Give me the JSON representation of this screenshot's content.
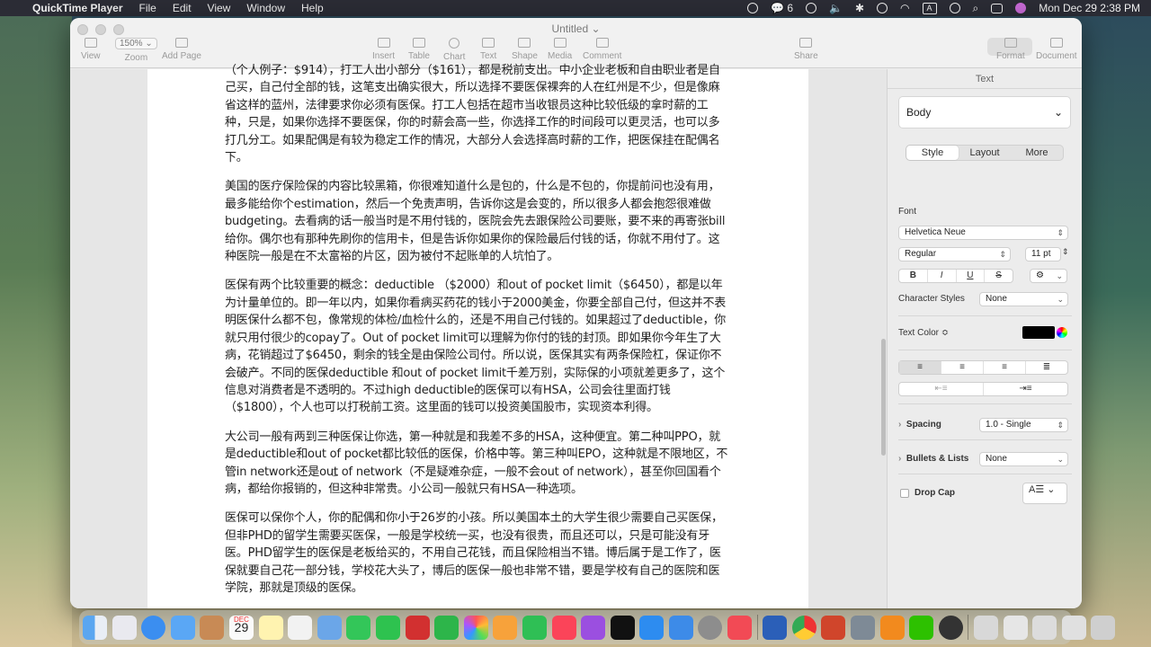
{
  "menubar": {
    "app_name": "QuickTime Player",
    "menus": [
      "File",
      "Edit",
      "View",
      "Window",
      "Help"
    ],
    "wechat_count": "6",
    "input_source": "A",
    "datetime": "Mon Dec 29  2:38 PM"
  },
  "window": {
    "title": "Untitled",
    "toolbar": {
      "view": "View",
      "zoom_value": "150%",
      "zoom": "Zoom",
      "add_page": "Add Page",
      "insert": "Insert",
      "table": "Table",
      "chart": "Chart",
      "text": "Text",
      "shape": "Shape",
      "media": "Media",
      "comment": "Comment",
      "share": "Share",
      "format": "Format",
      "document": "Document"
    }
  },
  "document": {
    "paragraphs": [
      "（个人例子：$914），打工人出小部分（$161），都是税前支出。中小企业老板和自由职业者是自己买，自己付全部的钱，这笔支出确实很大，所以选择不要医保裸奔的人在红州是不少，但是像麻省这样的蓝州，法律要求你必须有医保。打工人包括在超市当收银员这种比较低级的拿时薪的工种，只是，如果你选择不要医保，你的时薪会高一些，你选择工作的时间段可以更灵活，也可以多打几分工。如果配偶是有较为稳定工作的情况，大部分人会选择高时薪的工作，把医保挂在配偶名下。",
      "美国的医疗保险保的内容比较黑箱，你很难知道什么是包的，什么是不包的，你提前问也没有用，最多能给你个estimation，然后一个免责声明，告诉你这是会变的，所以很多人都会抱怨很难做budgeting。去看病的话一般当时是不用付钱的，医院会先去跟保险公司要账，要不来的再寄张bill给你。偶尔也有那种先刷你的信用卡，但是告诉你如果你的保险最后付钱的话，你就不用付了。这种医院一般是在不太富裕的片区，因为被付不起账单的人坑怕了。",
      "医保有两个比较重要的概念：deductible （$2000）和out of pocket limit（$6450），都是以年为计量单位的。即一年以内，如果你看病买药花的钱小于2000美金，你要全部自己付，但这并不表明医保什么都不包，像常规的体检/血检什么的，还是不用自己付钱的。如果超过了deductible，你就只用付很少的copay了。Out of pocket limit可以理解为你付的钱的封顶。即如果你今年生了大病，花销超过了$6450，剩余的钱全是由保险公司付。所以说，医保其实有两条保险杠，保证你不会破产。不同的医保deductible 和out of pocket limit千差万别，实际保的小项就差更多了，这个信息对消费者是不透明的。不过high deductible的医保可以有HSA，公司会往里面打钱（$1800），个人也可以打税前工资。这里面的钱可以投资美国股市，实现资本利得。",
      "大公司一般有两到三种医保让你选，第一种就是和我差不多的HSA，这种便宜。第二种叫PPO，就是deductible和out of pocket都比较低的医保，价格中等。第三种叫EPO，这种就是不限地区，不管in network还是out of network（不是疑难杂症，一般不会out of network），甚至你回国看个病，都给你报销的，但这种非常贵。小公司一般就只有HSA一种选项。",
      "医保可以保你个人，你的配偶和你小于26岁的小孩。所以美国本土的大学生很少需要自己买医保，但非PHD的留学生需要买医保，一般是学校统一买，也没有很贵，而且还可以，只是可能没有牙医。PHD留学生的医保是老板给买的，不用自己花钱，而且保险相当不错。博后属于是工作了，医保就要自己花一部分钱，学校花大头了，博后的医保一般也非常不错，要是学校有自己的医院和医学院，那就是顶级的医保。"
    ]
  },
  "sidebar": {
    "header": "Text",
    "paragraph_style": "Body",
    "tabs": [
      "Style",
      "Layout",
      "More"
    ],
    "font_label": "Font",
    "font_family": "Helvetica Neue",
    "font_style": "Regular",
    "font_size": "11 pt",
    "format_buttons": [
      "B",
      "I",
      "U",
      "S"
    ],
    "character_styles_label": "Character Styles",
    "character_styles_value": "None",
    "text_color_label": "Text Color ≎",
    "spacing_label": "Spacing",
    "spacing_value": "1.0 - Single",
    "bullets_label": "Bullets & Lists",
    "bullets_value": "None",
    "drop_cap_label": "Drop Cap"
  },
  "dock": {
    "calendar_month": "DEC",
    "calendar_day": "29",
    "apps": [
      "Finder",
      "Launchpad",
      "Safari",
      "Mail",
      "Contacts",
      "Freeform",
      "Preview",
      "Messages",
      "Facetime",
      "Photos",
      "Calendar",
      "Notes",
      "Numbers",
      "Pages",
      "Keynote",
      "Music",
      "Podcasts",
      "TV",
      "App Store",
      "Keynote",
      "System Settings",
      "News",
      "Word",
      "Chrome",
      "PowerPoint",
      "Preview",
      "Books",
      "WeChat",
      "QuickTime Player"
    ]
  }
}
